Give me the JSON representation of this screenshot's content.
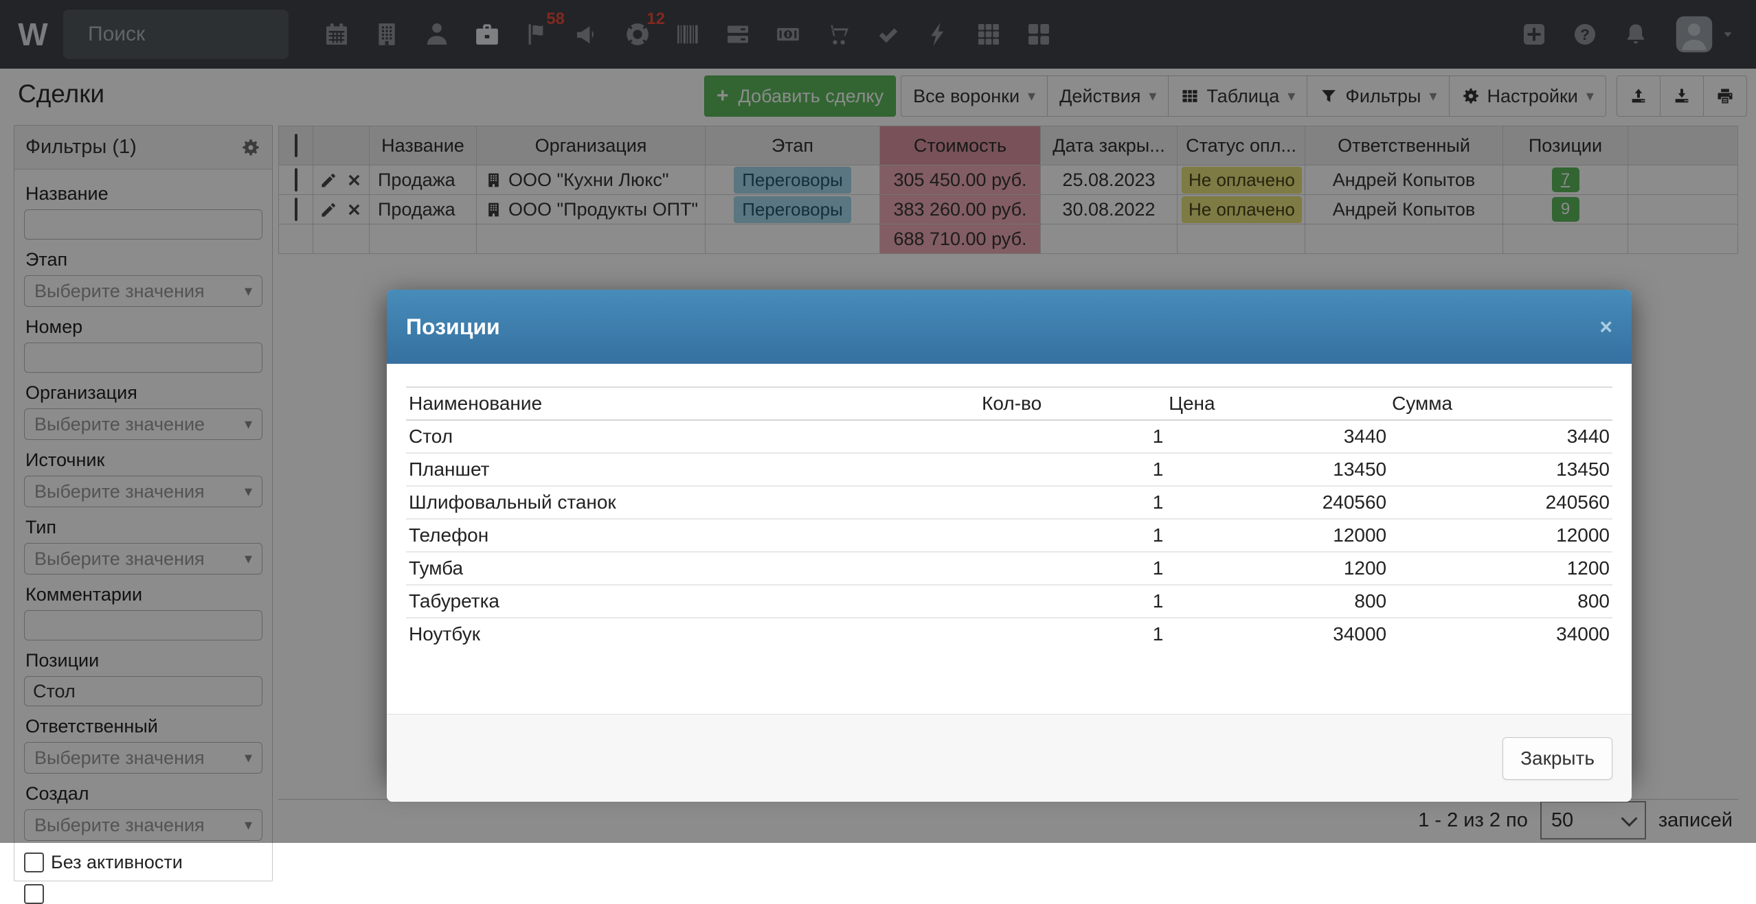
{
  "navbar": {
    "logo": "W",
    "search_placeholder": "Поиск",
    "flag_badge": "58",
    "lifering_badge": "12"
  },
  "page": {
    "title": "Сделки"
  },
  "toolbar": {
    "add_deal": "Добавить сделку",
    "funnels": "Все воронки",
    "actions": "Действия",
    "table": "Таблица",
    "filters": "Фильтры",
    "settings": "Настройки"
  },
  "filters_panel": {
    "title": "Фильтры (1)",
    "fields": [
      {
        "label": "Название",
        "control": "input",
        "value": ""
      },
      {
        "label": "Этап",
        "control": "select",
        "placeholder": "Выберите значения"
      },
      {
        "label": "Номер",
        "control": "input",
        "value": ""
      },
      {
        "label": "Организация",
        "control": "select",
        "placeholder": "Выберите значение"
      },
      {
        "label": "Источник",
        "control": "select",
        "placeholder": "Выберите значения"
      },
      {
        "label": "Тип",
        "control": "select",
        "placeholder": "Выберите значения"
      },
      {
        "label": "Комментарии",
        "control": "input",
        "value": ""
      },
      {
        "label": "Позиции",
        "control": "input",
        "value": "Стол"
      },
      {
        "label": "Ответственный",
        "control": "select",
        "placeholder": "Выберите значения"
      },
      {
        "label": "Создал",
        "control": "select",
        "placeholder": "Выберите значения"
      }
    ],
    "no_activity_label": "Без активности"
  },
  "deals_table": {
    "columns": {
      "name": "Название",
      "org": "Организация",
      "stage": "Этап",
      "amount": "Стоимость",
      "close_date": "Дата закры...",
      "pay_status": "Статус опл...",
      "owner": "Ответственный",
      "positions": "Позиции"
    },
    "rows": [
      {
        "name": "Продажа",
        "org": "ООО \"Кухни Люкс\"",
        "stage": "Переговоры",
        "amount": "305 450.00 руб.",
        "close_date": "25.08.2023",
        "pay_status": "Не оплачено",
        "owner": "Андрей Копытов",
        "positions": "7"
      },
      {
        "name": "Продажа",
        "org": "ООО \"Продукты ОПТ\"",
        "stage": "Переговоры",
        "amount": "383 260.00 руб.",
        "close_date": "30.08.2022",
        "pay_status": "Не оплачено",
        "owner": "Андрей Копытов",
        "positions": "9"
      }
    ],
    "total_amount": "688 710.00 руб."
  },
  "pagination": {
    "range_text": "1 - 2 из 2 по",
    "page_size": "50",
    "records_label": "записей"
  },
  "modal": {
    "title": "Позиции",
    "table": {
      "columns": [
        "Наименование",
        "Кол-во",
        "Цена",
        "Сумма"
      ],
      "rows": [
        [
          "Стол",
          "1",
          "3440",
          "3440"
        ],
        [
          "Планшет",
          "1",
          "13450",
          "13450"
        ],
        [
          "Шлифовальный станок",
          "1",
          "240560",
          "240560"
        ],
        [
          "Телефон",
          "1",
          "12000",
          "12000"
        ],
        [
          "Тумба",
          "1",
          "1200",
          "1200"
        ],
        [
          "Табуретка",
          "1",
          "800",
          "800"
        ],
        [
          "Ноутбук",
          "1",
          "34000",
          "34000"
        ]
      ]
    },
    "close_button": "Закрыть"
  },
  "colors": {
    "accent_green": "#5cb85c",
    "modal_header_blue": "#3d7aa9",
    "amount_pink": "#edaab4",
    "status_yellow": "#e6e07c",
    "stage_blue": "#a5d7ea",
    "badge_red": "#e74c3c",
    "navbar_dark": "#3f4347"
  }
}
